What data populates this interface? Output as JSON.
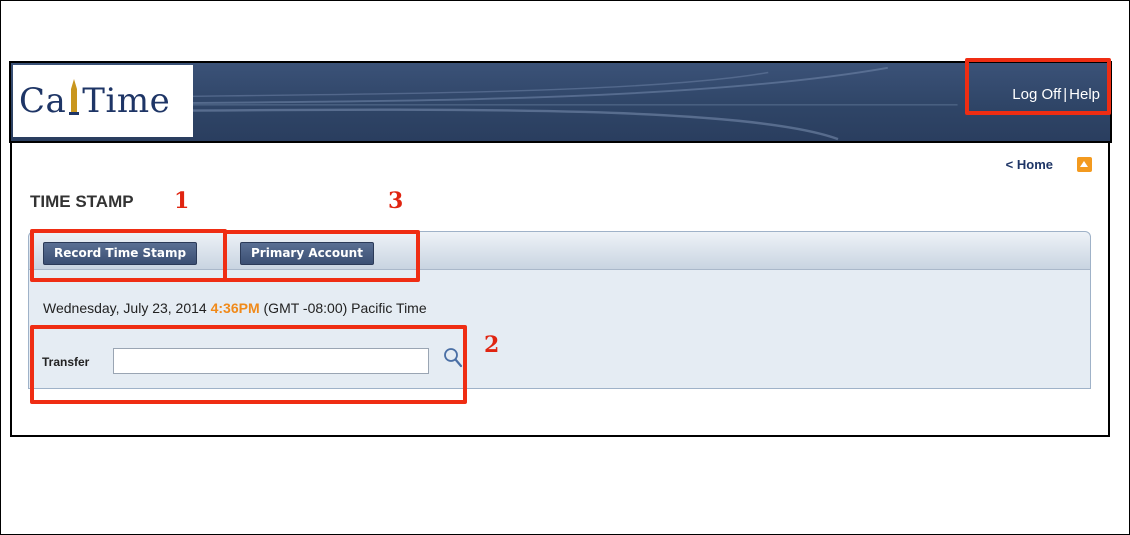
{
  "header": {
    "logo_text_left": "Ca",
    "logo_text_right": "Time",
    "log_off_label": "Log Off",
    "separator": "|",
    "help_label": "Help"
  },
  "nav": {
    "home_label": "< Home"
  },
  "page": {
    "title": "TIME STAMP"
  },
  "tabs": [
    {
      "label": "Record Time Stamp"
    },
    {
      "label": "Primary Account"
    }
  ],
  "datetime": {
    "date": "Wednesday, July 23, 2014",
    "time": "4:36PM",
    "zone": "(GMT -08:00) Pacific Time"
  },
  "transfer": {
    "label": "Transfer",
    "value": ""
  },
  "annotations": {
    "one": "1",
    "two": "2",
    "three": "3"
  },
  "colors": {
    "header_bg": "#2f4567",
    "accent_orange": "#f08a1a",
    "annotation_red": "#ef2d13",
    "tab_button": "#3b4f73",
    "panel_bg": "#e5ecf3"
  }
}
